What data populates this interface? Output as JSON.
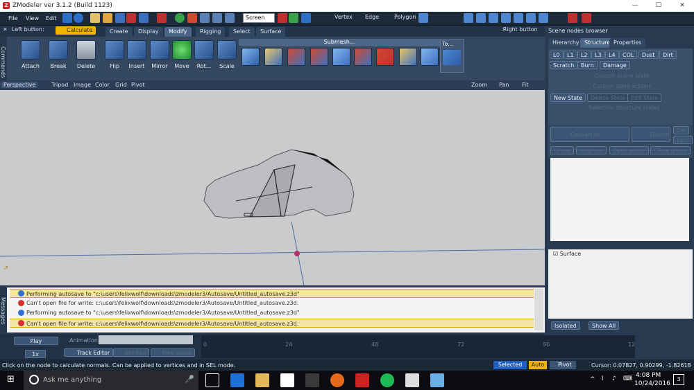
{
  "window": {
    "title": "ZModeler ver 3.1.2 (Build 1123)",
    "minimize": "—",
    "maximize": "☐",
    "close": "✕",
    "app_icon_letter": "Z"
  },
  "menu": [
    "File",
    "View",
    "Edit"
  ],
  "toolbar": {
    "coord_select": "Screen",
    "modes": [
      "Vertex",
      "Edge",
      "Polygon"
    ]
  },
  "commands": {
    "left_button_label": "Left button:",
    "calculate": "Calculate",
    "right_button_label": ":Right button",
    "side_label": "Commands",
    "tabs": [
      "Create",
      "Display",
      "Modify",
      "Rigging",
      "Select",
      "Surface"
    ],
    "active_tab": "Modify",
    "buttons": [
      "Attach",
      "Break",
      "Delete",
      "Flip",
      "Insert",
      "Mirror",
      "Move",
      "Rot...",
      "Scale"
    ],
    "submesh_label": "Submesh...",
    "to_label": "To..."
  },
  "viewport": {
    "name": "Perspective",
    "items": [
      "Tripod",
      "Image",
      "Color",
      "Grid",
      "Pivot"
    ],
    "nav": [
      "Zoom",
      "Pan",
      "Fit"
    ]
  },
  "scene_browser": {
    "title": "Scene nodes browser",
    "tabs": [
      "Hierarchy",
      "Structure",
      "Properties"
    ],
    "active_tab": "Structure",
    "lod_buttons": [
      "L0",
      "L1",
      "L2",
      "L3",
      "L4",
      "COL",
      "Dust",
      "Dirt"
    ],
    "row2": [
      "Scratch",
      "Burn",
      "Damage"
    ],
    "custom_scene_state": "Custom scene state",
    "custom_state_actions": "Custom state actions",
    "state_buttons": [
      "New State",
      "Delete State",
      "Edit State"
    ],
    "selection_structure_states": "Selection structure states",
    "convert_compound": "Convert to Compound",
    "dismiss": "Dismis",
    "del": "Del",
    "lock": "Lock",
    "group_buttons": [
      "Group",
      "Ungroup",
      "Open group",
      "Close group"
    ],
    "surface_item": "Surface",
    "isolated": "Isolated",
    "show_all": "Show All"
  },
  "messages": {
    "side_label": "Messages",
    "lines": [
      {
        "text": "Performing autosave to \"c:\\users\\felixwolf\\downloads\\zmodeler3/Autosave/Untitled_autosave.z3d\"",
        "type": "info",
        "highlight": true
      },
      {
        "text": "Can't open file for write: c:\\users\\felixwolf\\downloads\\zmodeler3/Autosave/Untitled_autosave.z3d.",
        "type": "error",
        "highlight": false
      },
      {
        "text": "Performing autosave to \"c:\\users\\felixwolf\\downloads\\zmodeler3/Autosave/Untitled_autosave.z3d\"",
        "type": "info",
        "highlight": false
      },
      {
        "text": "Can't open file for write: c:\\users\\felixwolf\\downloads\\zmodeler3/Autosave/Untitled_autosave.z3d.",
        "type": "error",
        "highlight": true
      }
    ]
  },
  "timeline": {
    "play": "Play",
    "speed": "1x",
    "animation_label": "Animation:",
    "track_editor": "Track Editor",
    "set_key": "Set Key",
    "free_mode": "Free mode",
    "ticks": [
      "0",
      "24",
      "48",
      "72",
      "96",
      "12"
    ]
  },
  "status": {
    "hint": "Click on the node to calculate normals. Can be applied to vertices and in SEL mode.",
    "selected": "Selected",
    "auto": "Auto",
    "pivot": "Pivot",
    "cursor": "Cursor: 0.07827, 0.90299, -1.82618"
  },
  "taskbar": {
    "search_placeholder": "Ask me anything",
    "time": "4:08 PM",
    "date": "10/24/2016",
    "notification_count": "3"
  },
  "colors": {
    "accent_yellow": "#f0b400",
    "panel": "#34485f",
    "viewport_bg": "#c9cbcd",
    "error_red": "#d32f2f",
    "info_blue": "#2f6fd6"
  }
}
